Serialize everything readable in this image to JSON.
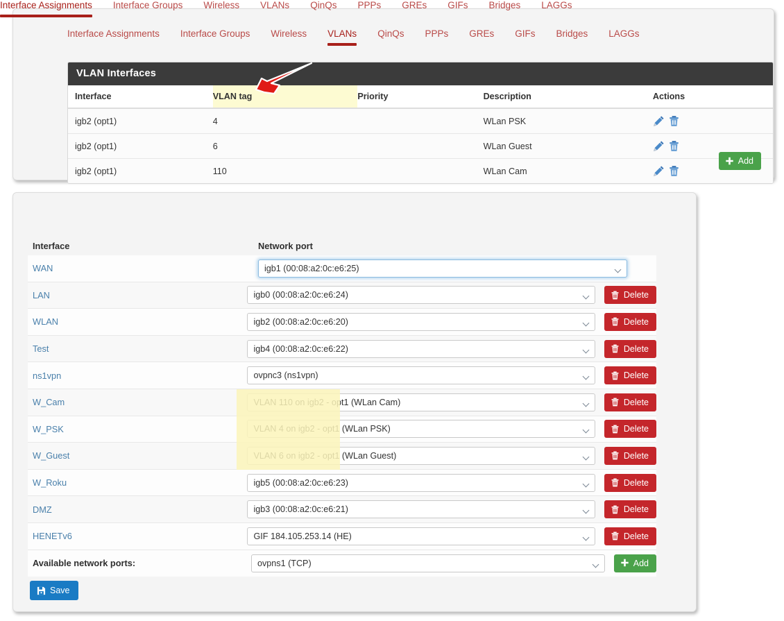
{
  "vlan_panel": {
    "tabs": [
      {
        "label": "Interface Assignments",
        "active": false
      },
      {
        "label": "Interface Groups",
        "active": false
      },
      {
        "label": "Wireless",
        "active": false
      },
      {
        "label": "VLANs",
        "active": true
      },
      {
        "label": "QinQs",
        "active": false
      },
      {
        "label": "PPPs",
        "active": false
      },
      {
        "label": "GREs",
        "active": false
      },
      {
        "label": "GIFs",
        "active": false
      },
      {
        "label": "Bridges",
        "active": false
      },
      {
        "label": "LAGGs",
        "active": false
      }
    ],
    "card_title": "VLAN Interfaces",
    "columns": [
      "Interface",
      "VLAN tag",
      "Priority",
      "Description",
      "Actions"
    ],
    "highlighted_column": "VLAN tag",
    "rows": [
      {
        "interface": "igb2 (opt1)",
        "vlan_tag": "4",
        "priority": "",
        "description": "WLan PSK",
        "edit_icon": "pencil-icon",
        "delete_icon": "trash-icon"
      },
      {
        "interface": "igb2 (opt1)",
        "vlan_tag": "6",
        "priority": "",
        "description": "WLan Guest",
        "edit_icon": "pencil-icon",
        "delete_icon": "trash-icon"
      },
      {
        "interface": "igb2 (opt1)",
        "vlan_tag": "110",
        "priority": "",
        "description": "WLan Cam",
        "edit_icon": "pencil-icon",
        "delete_icon": "trash-icon"
      }
    ],
    "add_label": "Add"
  },
  "assign_panel": {
    "tabs": [
      {
        "label": "Interface Assignments",
        "active": true
      },
      {
        "label": "Interface Groups",
        "active": false
      },
      {
        "label": "Wireless",
        "active": false
      },
      {
        "label": "VLANs",
        "active": false
      },
      {
        "label": "QinQs",
        "active": false
      },
      {
        "label": "PPPs",
        "active": false
      },
      {
        "label": "GREs",
        "active": false
      },
      {
        "label": "GIFs",
        "active": false
      },
      {
        "label": "Bridges",
        "active": false
      },
      {
        "label": "LAGGs",
        "active": false
      }
    ],
    "headers": {
      "interface": "Interface",
      "network_port": "Network port"
    },
    "rows": [
      {
        "interface": "WAN",
        "port": "igb1 (00:08:a2:0c:e6:25)",
        "delete": null,
        "focused": true,
        "highlight": false
      },
      {
        "interface": "LAN",
        "port": "igb0 (00:08:a2:0c:e6:24)",
        "delete": "Delete",
        "focused": false,
        "highlight": false
      },
      {
        "interface": "WLAN",
        "port": "igb2 (00:08:a2:0c:e6:20)",
        "delete": "Delete",
        "focused": false,
        "highlight": false
      },
      {
        "interface": "Test",
        "port": "igb4 (00:08:a2:0c:e6:22)",
        "delete": "Delete",
        "focused": false,
        "highlight": false
      },
      {
        "interface": "ns1vpn",
        "port": "ovpnc3 (ns1vpn)",
        "delete": "Delete",
        "focused": false,
        "highlight": false
      },
      {
        "interface": "W_Cam",
        "port": "VLAN 110 on igb2 - opt1 (WLan Cam)",
        "delete": "Delete",
        "focused": false,
        "highlight": true
      },
      {
        "interface": "W_PSK",
        "port": "VLAN 4 on igb2 - opt1 (WLan PSK)",
        "delete": "Delete",
        "focused": false,
        "highlight": true
      },
      {
        "interface": "W_Guest",
        "port": "VLAN 6 on igb2 - opt1 (WLan Guest)",
        "delete": "Delete",
        "focused": false,
        "highlight": true
      },
      {
        "interface": "W_Roku",
        "port": "igb5 (00:08:a2:0c:e6:23)",
        "delete": "Delete",
        "focused": false,
        "highlight": false
      },
      {
        "interface": "DMZ",
        "port": "igb3 (00:08:a2:0c:e6:21)",
        "delete": "Delete",
        "focused": false,
        "highlight": false
      },
      {
        "interface": "HENETv6",
        "port": "GIF 184.105.253.14 (HE)",
        "delete": "Delete",
        "focused": false,
        "highlight": false
      }
    ],
    "available_ports_label": "Available network ports:",
    "available_ports_value": "ovpns1 (TCP)",
    "add_label": "Add",
    "save_label": "Save"
  },
  "annotation": {
    "type": "red-arrow",
    "points_to": "VLAN tag",
    "color": "#e01b16"
  },
  "colors": {
    "tab_red": "#a8201a",
    "card_header": "#3b3b3b",
    "highlight_yellow": "#fbf5ba",
    "delete_red": "#c4262b",
    "add_green": "#4aa24a",
    "save_blue": "#1a7bc4",
    "link_blue": "#4a80ab"
  }
}
